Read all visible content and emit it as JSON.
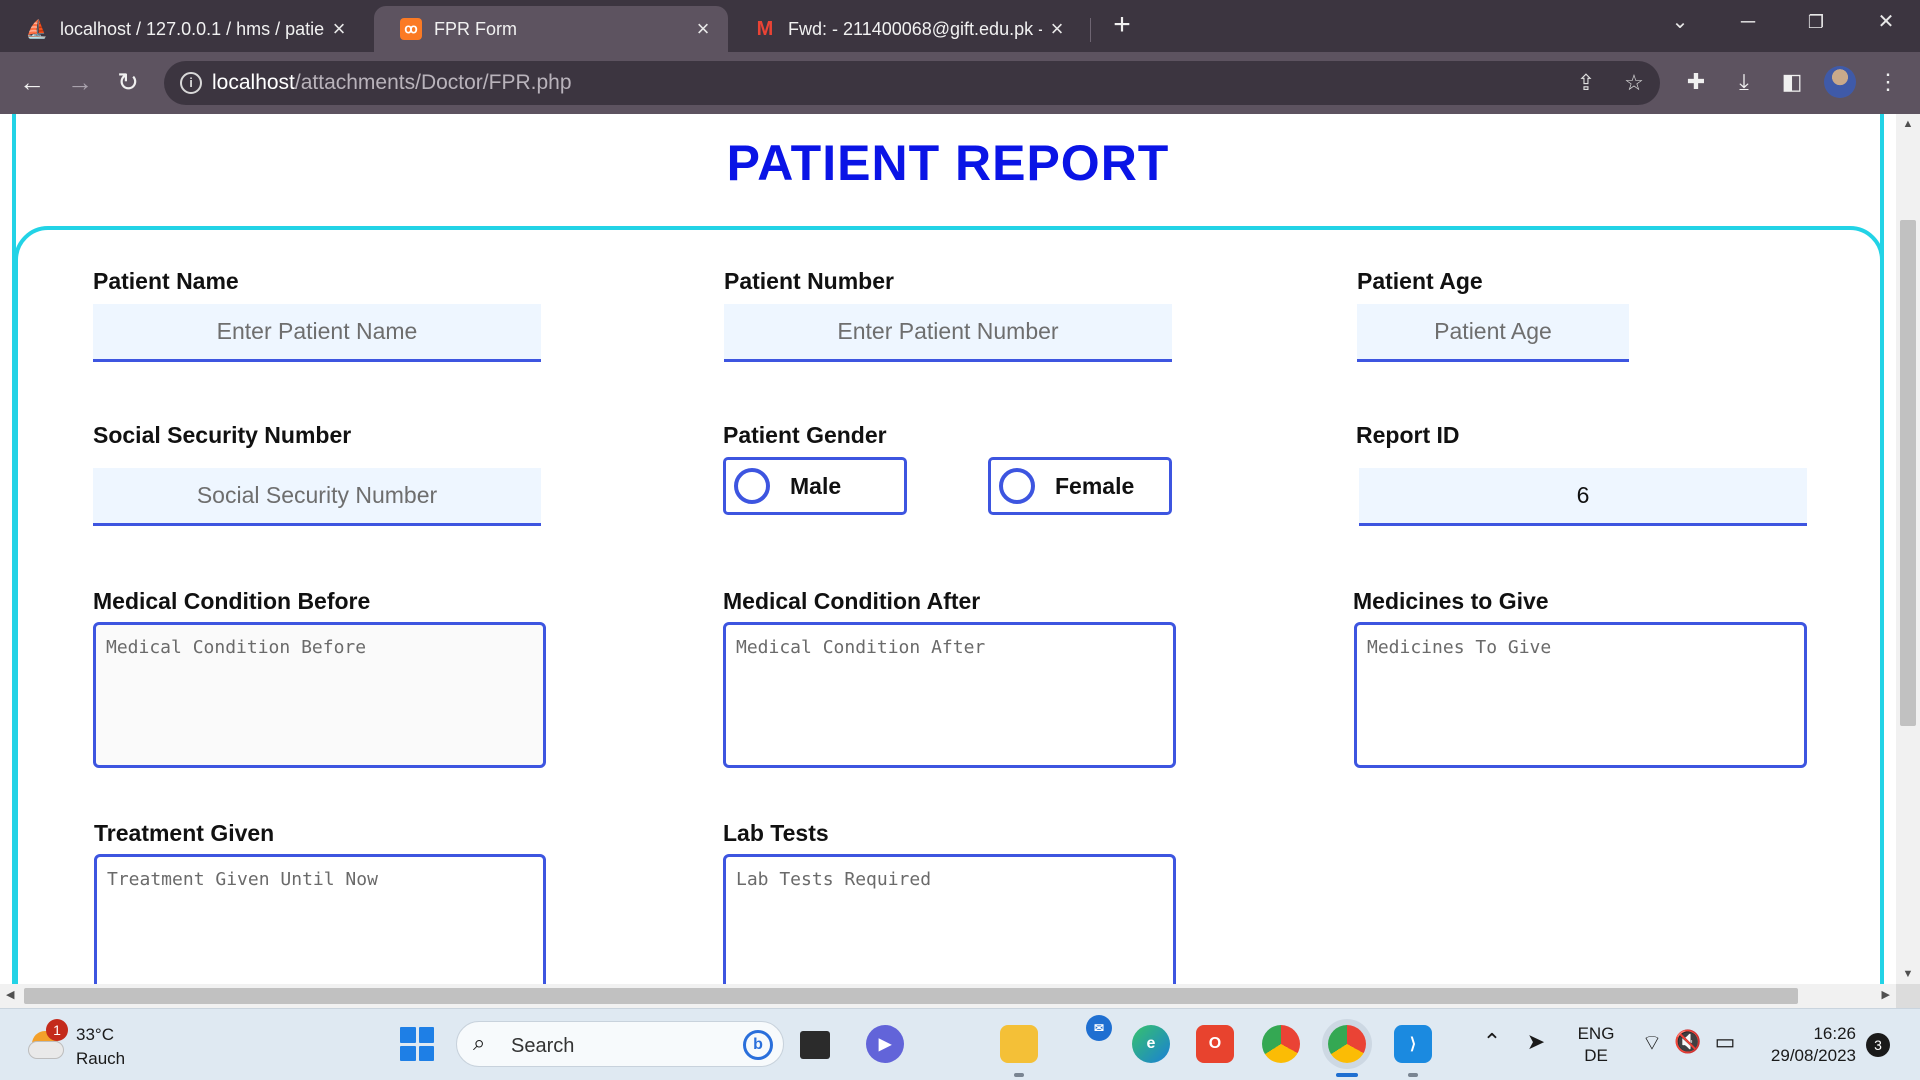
{
  "browser": {
    "tabs": [
      {
        "title": "localhost / 127.0.0.1 / hms / patie",
        "icon": "phpmyadmin-icon",
        "active": false
      },
      {
        "title": "FPR Form",
        "icon": "xampp-icon",
        "active": true
      },
      {
        "title": "Fwd: - 211400068@gift.edu.pk -",
        "icon": "gmail-icon",
        "active": false
      }
    ],
    "url_host": "localhost",
    "url_path": "/attachments/Doctor/FPR.php"
  },
  "page": {
    "title": "PATIENT REPORT",
    "fields": {
      "patient_name": {
        "label": "Patient Name",
        "placeholder": "Enter Patient Name"
      },
      "patient_number": {
        "label": "Patient Number",
        "placeholder": "Enter Patient Number"
      },
      "patient_age": {
        "label": "Patient Age",
        "placeholder": "Patient Age"
      },
      "ssn": {
        "label": "Social Security Number",
        "placeholder": "Social Security Number"
      },
      "gender": {
        "label": "Patient Gender",
        "options": [
          "Male",
          "Female"
        ]
      },
      "report_id": {
        "label": "Report ID",
        "value": "6"
      },
      "condition_before": {
        "label": "Medical Condition Before",
        "placeholder": "Medical Condition Before"
      },
      "condition_after": {
        "label": "Medical Condition After",
        "placeholder": "Medical Condition After"
      },
      "medicines": {
        "label": "Medicines to Give",
        "placeholder": "Medicines To Give"
      },
      "treatment": {
        "label": "Treatment Given",
        "placeholder": "Treatment Given Until Now"
      },
      "lab_tests": {
        "label": "Lab Tests",
        "placeholder": "Lab Tests Required"
      }
    }
  },
  "taskbar": {
    "weather_temp": "33°C",
    "weather_desc": "Rauch",
    "weather_badge": "1",
    "search_placeholder": "Search",
    "lang_top": "ENG",
    "lang_bottom": "DE",
    "time": "16:26",
    "date": "29/08/2023",
    "notification_count": "3"
  },
  "colors": {
    "title_blue": "#0a14e6",
    "accent_cyan": "#22d3e6",
    "input_border": "#3d55e0",
    "input_bg": "#eef6ff"
  }
}
